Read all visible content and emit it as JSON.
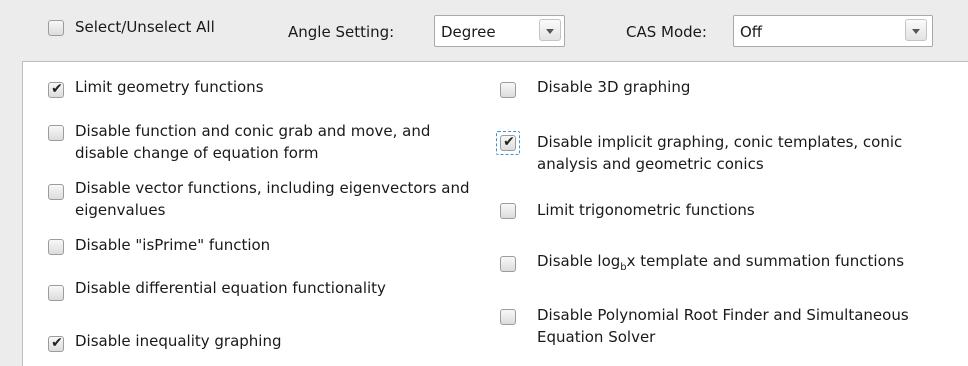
{
  "top_bar": {
    "select_all_label": "Select/Unselect All",
    "angle_setting_label": "Angle Setting:",
    "angle_setting_value": "Degree",
    "cas_mode_label": "CAS Mode:",
    "cas_mode_value": "Off"
  },
  "options_left": [
    {
      "label": "Limit geometry functions",
      "checked": true
    },
    {
      "label": "Disable function and conic grab and move, and disable change of equation form",
      "checked": false
    },
    {
      "label": "Disable vector functions, including eigenvectors and eigenvalues",
      "checked": false
    },
    {
      "label": "Disable \"isPrime\" function",
      "checked": false
    },
    {
      "label": "Disable differential equation functionality",
      "checked": false
    },
    {
      "label": "Disable inequality graphing",
      "checked": true
    }
  ],
  "options_right": [
    {
      "label": "Disable 3D graphing",
      "checked": false
    },
    {
      "label": "Disable implicit graphing, conic templates, conic analysis and geometric conics",
      "checked": true,
      "focused": true
    },
    {
      "label": "Limit trigonometric functions",
      "checked": false
    },
    {
      "label_prefix": "Disable log",
      "label_sub": "b",
      "label_suffix": "x template and summation functions",
      "checked": false
    },
    {
      "label": "Disable Polynomial Root Finder and Simultaneous Equation Solver",
      "checked": false
    }
  ],
  "check_glyph": "✔"
}
